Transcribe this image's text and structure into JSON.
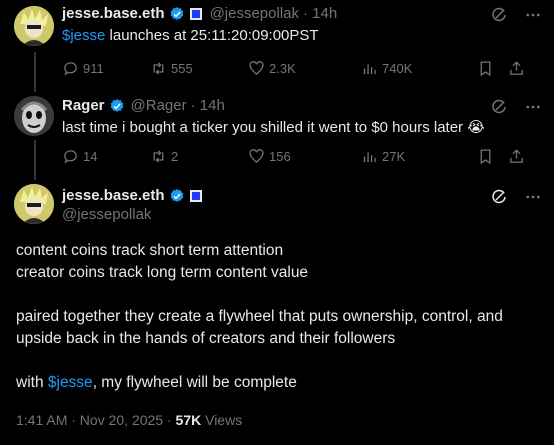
{
  "tweet1": {
    "display_name": "jesse.base.eth",
    "handle": "@jessepollak",
    "time": "· 14h",
    "text_link": "$jesse",
    "text_rest": " launches at 25:11:20:09:00PST",
    "replies": "911",
    "reposts": "555",
    "likes": "2.3K",
    "views": "740K"
  },
  "tweet2": {
    "display_name": "Rager",
    "handle": "@Rager",
    "time": "· 14h",
    "text": "last time i bought a ticker you shilled it went to $0 hours later 😭",
    "replies": "14",
    "reposts": "2",
    "likes": "156",
    "views": "27K"
  },
  "main": {
    "display_name": "jesse.base.eth",
    "handle": "@jessepollak",
    "line1": "content coins track short term attention",
    "line2": "creator coins track long term content value",
    "line3": "paired together they create a flywheel that puts ownership, control, and",
    "line4": "upside back in the hands of creators and their followers",
    "line5_pre": "with ",
    "line5_link": "$jesse",
    "line5_post": ", my flywheel will be complete",
    "timestamp": "1:41 AM · Nov 20, 2025 · ",
    "views_count": "57K",
    "views_label": " Views"
  },
  "icons": {
    "verified": "verified-badge-icon",
    "grok": "grok-icon",
    "more": "more-icon",
    "reply": "reply-icon",
    "repost": "repost-icon",
    "like": "like-icon",
    "views": "views-icon",
    "bookmark": "bookmark-icon",
    "share": "share-icon"
  },
  "colors": {
    "background": "#000000",
    "text": "#e7e9ea",
    "secondary": "#71767b",
    "link": "#1d9bf0",
    "verified": "#1d9bf0"
  }
}
